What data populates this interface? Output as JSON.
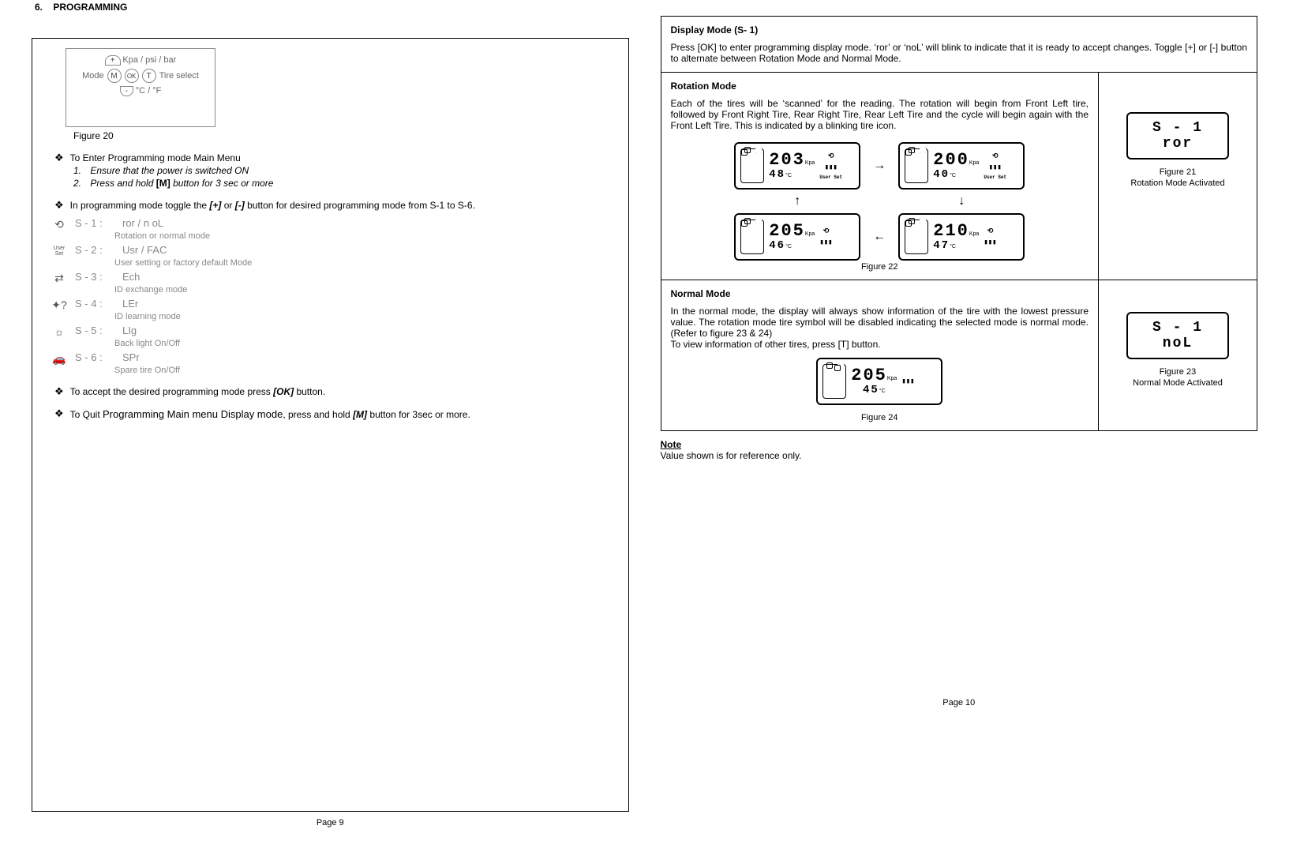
{
  "left": {
    "section_no": "6.",
    "section_title": "PROGRAMMING",
    "fig20": {
      "top_label": "Kpa / psi / bar",
      "left_label": "Mode",
      "right_label": "Tire select",
      "bottom_label": "°C / °F",
      "btn_plus": "+",
      "btn_minus": "-",
      "btn_m": "M",
      "btn_ok": "OK",
      "btn_t": "T",
      "caption": "Figure 20"
    },
    "b1": {
      "text": "To Enter Programming mode Main Menu",
      "step1_pre": "Ensure that the power is switched ON",
      "step2_pre": "Press and hold ",
      "step2_btn": "[M]",
      "step2_post": " button for 3 sec or more"
    },
    "b2": {
      "pre": "In programming mode toggle the ",
      "btn1": "[+]",
      "mid": " or ",
      "btn2": "[-]",
      "post": " button for desired programming mode from S-1 to S-6."
    },
    "modes": {
      "m1_code": "S - 1 :",
      "m1_val": "ror / n oL",
      "m1_desc": "Rotation or normal mode",
      "m2_code": "S - 2 :",
      "m2_val": "Usr / FAC",
      "m2_desc": "User setting or factory default Mode",
      "m2_iconlabel": "User Set",
      "m3_code": "S - 3 :",
      "m3_val": "Ech",
      "m3_desc": "ID exchange mode",
      "m4_code": "S - 4 :",
      "m4_val": "LEr",
      "m4_desc": "ID learning mode",
      "m5_code": "S - 5 :",
      "m5_val": "LIg",
      "m5_desc": "Back light On/Off",
      "m6_code": "S - 6 :",
      "m6_val": "SPr",
      "m6_desc": "Spare tire On/Off"
    },
    "b3": {
      "pre": "To accept the desired programming mode press ",
      "btn": "[OK]",
      "post": " button."
    },
    "b4": {
      "pre": "To Quit ",
      "big": "Programming Main menu Display mode",
      "mid": ", press and hold ",
      "btn": "[M]",
      "post": " button for 3sec or more."
    },
    "page_num": "Page 9"
  },
  "right": {
    "s1": {
      "title": "Display Mode (S- 1)",
      "body": "Press [OK] to enter programming display mode. ‘ror’ or ‘noL’ will blink to indicate that it is ready to accept changes. Toggle [+] or [-] button to alternate between Rotation Mode and Normal Mode."
    },
    "rotation": {
      "title": "Rotation Mode",
      "body": "Each of the tires will be ‘scanned’ for the reading. The rotation will begin from Front Left tire, followed by Front Right Tire, Rear Right Tire, Rear Left Tire and the cycle will begin again with the Front Left Tire. This is indicated by a blinking tire icon.",
      "tiles": {
        "fl_p": "203",
        "fl_t": "48",
        "fr_p": "200",
        "fr_t": "40",
        "rl_p": "205",
        "rl_t": "46",
        "rr_p": "210",
        "rr_t": "47",
        "unit_p": "Kpa",
        "unit_t": "°C",
        "userset": "User Set"
      },
      "arrows": {
        "right": "→",
        "down": "↓",
        "left": "←",
        "up": "↑"
      },
      "fig22": "Figure 22",
      "side_lcd_l1": "S - 1",
      "side_lcd_l2": "ror",
      "fig21": "Figure 21",
      "fig21_sub": "Rotation Mode Activated"
    },
    "normal": {
      "title": "Normal Mode",
      "body1": "In the normal mode, the display will always show information of the tire with the lowest pressure value. The rotation mode tire symbol will be disabled indicating the selected mode is normal mode. (Refer to figure 23 & 24)",
      "body2": "To view information of other tires, press [T] button.",
      "tile_p": "205",
      "tile_t": "45",
      "unit_p": "Kpa",
      "unit_t": "°C",
      "fig24": "Figure 24",
      "side_lcd_l1": "S - 1",
      "side_lcd_l2": "noL",
      "fig23": "Figure 23",
      "fig23_sub": "Normal Mode Activated"
    },
    "note_label": "Note",
    "note_body": "Value shown is for reference only.",
    "page_num": "Page 10"
  }
}
